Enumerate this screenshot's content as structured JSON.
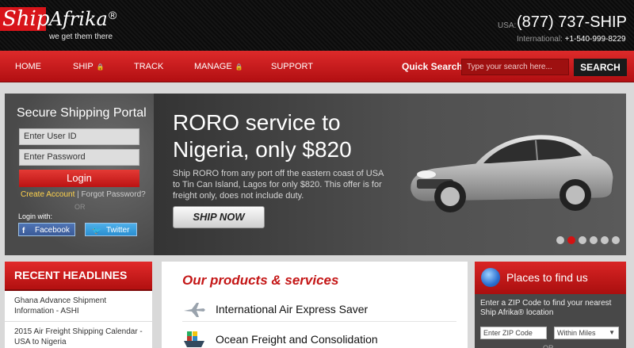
{
  "brand": {
    "logo_ship": "Ship",
    "logo_afrika": "Afrika",
    "logo_reg": "®",
    "tagline": "we get them there"
  },
  "contact": {
    "usa_label": "USA:",
    "usa_phone": "(877) 737-SHIP",
    "intl_label": "International:",
    "intl_phone": "+1-540-999-8229"
  },
  "nav": {
    "items": [
      {
        "label": "HOME",
        "locked": false
      },
      {
        "label": "SHIP",
        "locked": true
      },
      {
        "label": "TRACK",
        "locked": false
      },
      {
        "label": "MANAGE",
        "locked": true
      },
      {
        "label": "SUPPORT",
        "locked": false
      }
    ],
    "lock_glyph": "🔒",
    "quick_search_label": "Quick Search :",
    "search_placeholder": "Type your search here...",
    "search_button": "SEARCH"
  },
  "portal": {
    "title": "Secure Shipping Portal",
    "user_id_placeholder": "Enter User ID",
    "password_placeholder": "Enter Password",
    "login_button": "Login",
    "create_account": "Create Account",
    "separator": "|",
    "forgot_password": "Forgot Password?",
    "or": "OR",
    "login_with": "Login with:",
    "facebook": "Facebook",
    "twitter": "Twitter"
  },
  "promo": {
    "title": "RORO service to Nigeria, only $820",
    "body": "Ship RORO from any port off the eastern coast of USA to Tin Can Island, Lagos for only $820. This offer is for freight only, does not include duty.",
    "cta": "SHIP NOW",
    "slide_count": 6,
    "active_slide": 2
  },
  "headlines": {
    "title": "RECENT HEADLINES",
    "items": [
      "Ghana Advance Shipment Information - ASHI",
      "2015 Air Freight Shipping Calendar - USA to Nigeria"
    ]
  },
  "products": {
    "title": "Our products & services",
    "items": [
      {
        "label": "International Air Express Saver",
        "icon": "airplane-icon"
      },
      {
        "label": "Ocean Freight and Consolidation",
        "icon": "cargo-ship-icon"
      }
    ]
  },
  "locator": {
    "title": "Places to find us",
    "description": "Enter a ZIP Code to find your nearest Ship Afrika® location",
    "zip_placeholder": "Enter ZIP Code",
    "radius_selected": "Within Miles",
    "or": "OR"
  },
  "colors": {
    "brand_red": "#d8141a",
    "dark": "#1a1a1a",
    "accent_yellow": "#ffd34d"
  }
}
